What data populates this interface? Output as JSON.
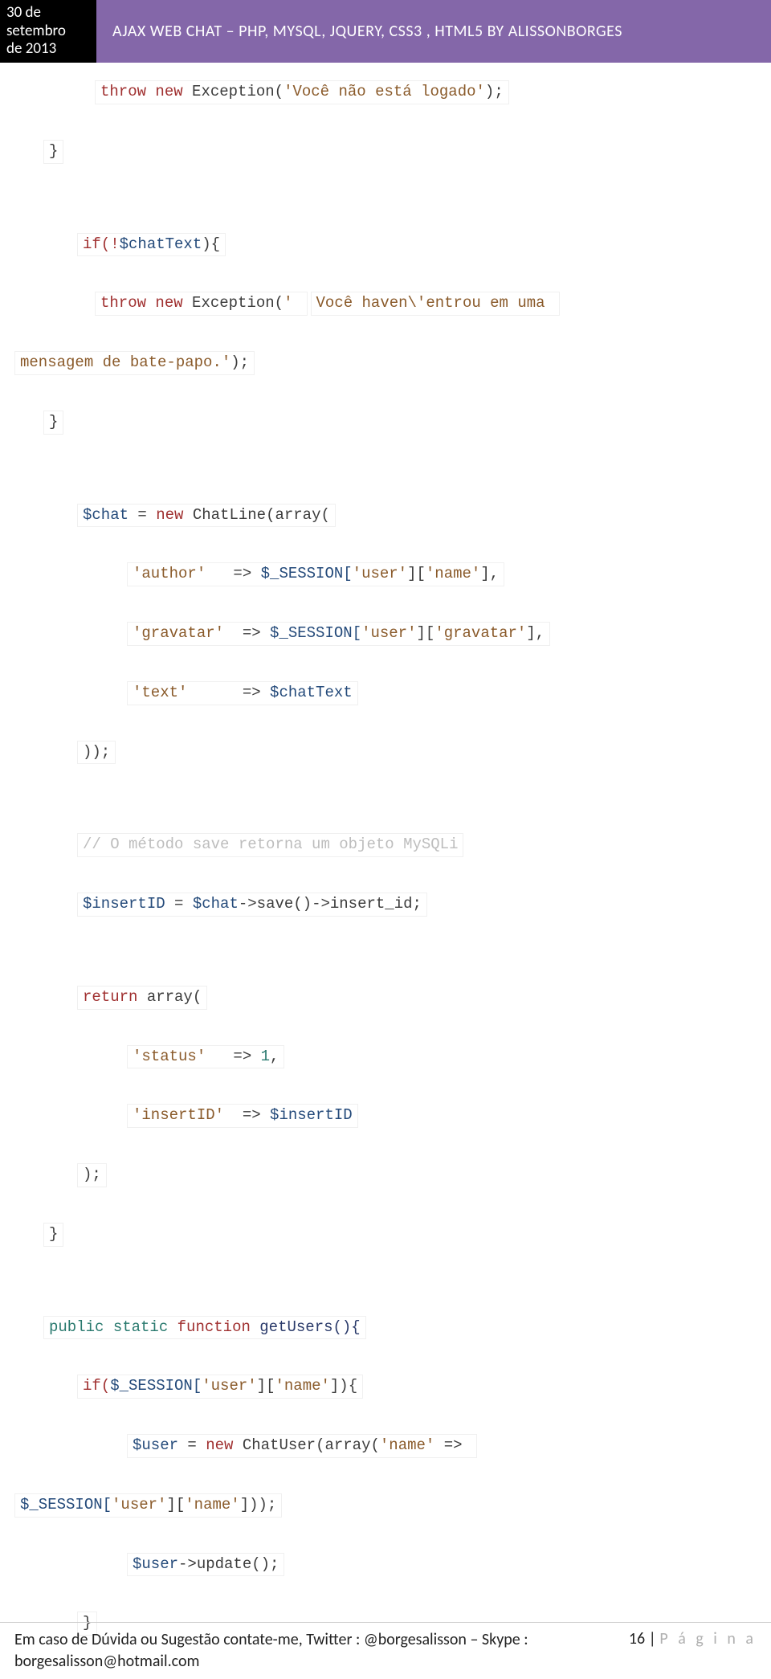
{
  "header": {
    "date_line1": "30 de",
    "date_line2": "setembro",
    "date_line3": "de 2013",
    "title": "AJAX WEB CHAT – PHP, MYSQL, JQUERY, CSS3 , HTML5 BY ALISSONBORGES"
  },
  "code": {
    "l01_throw": "throw",
    "l01_new": "new",
    "l01_exc": "Exception(",
    "l01_str": "'Você não está logado'",
    "l01_close": ");",
    "l02_brace": "}",
    "l03_if": "if(!",
    "l03_var": "$chatText",
    "l03_close": "){",
    "l04_throw": "throw",
    "l04_new": "new",
    "l04_exc": "Exception(",
    "l04_str1": "' ",
    "l04_str2": "Você haven\\'entrou em uma ",
    "l05_str": "mensagem de bate-papo.'",
    "l05_close": ");",
    "l06_brace": "}",
    "l07_var": "$chat",
    "l07_eq": " = ",
    "l07_new": "new",
    "l07_cls": " ChatLine(array(",
    "l08_key": "'author'",
    "l08_arrow": "   => ",
    "l08_sess": "$_SESSION[",
    "l08_u": "'user'",
    "l08_br1": "][",
    "l08_n": "'name'",
    "l08_br2": "],",
    "l09_key": "'gravatar'",
    "l09_arrow": "  => ",
    "l09_sess": "$_SESSION[",
    "l09_u": "'user'",
    "l09_br1": "][",
    "l09_g": "'gravatar'",
    "l09_br2": "],",
    "l10_key": "'text'",
    "l10_arrow": "      => ",
    "l10_var": "$chatText",
    "l11_close": "));",
    "l12_comment": "// O método save retorna um objeto MySQLi",
    "l13_var1": "$insertID",
    "l13_eq": " = ",
    "l13_var2": "$chat",
    "l13_rest": "->save()->insert_id;",
    "l14_return": "return",
    "l14_arr": " array(",
    "l15_key": "'status'",
    "l15_arrow": "   => ",
    "l15_num": "1",
    "l15_c": ",",
    "l16_key": "'insertID'",
    "l16_arrow": "  => ",
    "l16_var": "$insertID",
    "l17_close": ");",
    "l18_brace": "}",
    "l19_public": "public",
    "l19_static": "static",
    "l19_function": "function",
    "l19_name": " getUsers(){",
    "l20_if": "if(",
    "l20_sess": "$_SESSION[",
    "l20_u": "'user'",
    "l20_br1": "][",
    "l20_n": "'name'",
    "l20_br2": "]){",
    "l21_var": "$user",
    "l21_eq": " = ",
    "l21_new": "new",
    "l21_cls": " ChatUser(array(",
    "l21_key": "'name'",
    "l21_arrow": " => ",
    "l22_sess": "$_SESSION[",
    "l22_u": "'user'",
    "l22_br1": "][",
    "l22_n": "'name'",
    "l22_br2": "]));",
    "l23_var": "$user",
    "l23_rest": "->update();",
    "l24_brace": "}"
  },
  "footer": {
    "contact": "Em caso de Dúvida ou Sugestão contate-me, Twitter : @borgesalisson – Skype : borgesalisson@hotmail.com",
    "page_num": "16",
    "page_sep": " | ",
    "page_word": "P á g i n a"
  }
}
